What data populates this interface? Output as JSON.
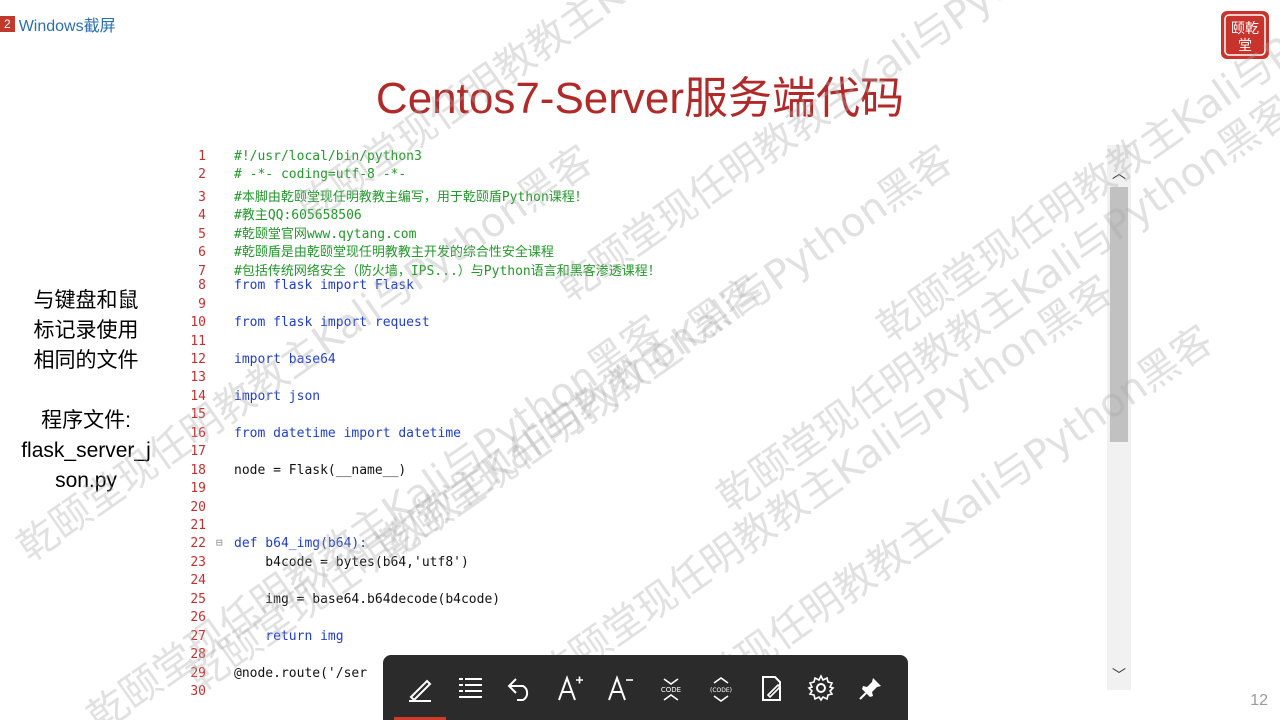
{
  "header": {
    "badge_number": "2",
    "badge_text": "Windows截屏"
  },
  "logo": {
    "text": "乾颐堂"
  },
  "title": "Centos7-Server服务端代码",
  "side_note": {
    "line1": "与键盘和鼠",
    "line2": "标记录使用",
    "line3": "相同的文件",
    "line4": "程序文件:",
    "line5": "flask_server_j",
    "line6": "son.py"
  },
  "code": {
    "lines": [
      {
        "n": "1",
        "t": "#!/usr/local/bin/python3",
        "c": "tok-c"
      },
      {
        "n": "2",
        "t": "# -*- coding=utf-8 -*-",
        "c": "tok-c"
      },
      {
        "n": "3",
        "t": "#本脚由乾颐堂现任明教教主编写，用于乾颐盾Python课程！",
        "c": "tok-c"
      },
      {
        "n": "4",
        "t": "#教主QQ:605658506",
        "c": "tok-c"
      },
      {
        "n": "5",
        "t": "#乾颐堂官网www.qytang.com",
        "c": "tok-c"
      },
      {
        "n": "6",
        "t": "#乾颐盾是由乾颐堂现任明教教主开发的综合性安全课程",
        "c": "tok-c"
      },
      {
        "n": "7",
        "t": "#包括传统网络安全（防火墙，IPS...）与Python语言和黑客渗透课程！",
        "c": "tok-c"
      },
      {
        "n": "8",
        "t": "from flask import Flask",
        "c": "tok-k"
      },
      {
        "n": "9",
        "t": "",
        "c": "tok-n"
      },
      {
        "n": "10",
        "t": "from flask import request",
        "c": "tok-k"
      },
      {
        "n": "11",
        "t": "",
        "c": "tok-n"
      },
      {
        "n": "12",
        "t": "import base64",
        "c": "tok-k"
      },
      {
        "n": "13",
        "t": "",
        "c": "tok-n"
      },
      {
        "n": "14",
        "t": "import json",
        "c": "tok-k"
      },
      {
        "n": "15",
        "t": "",
        "c": "tok-n"
      },
      {
        "n": "16",
        "t": "from datetime import datetime",
        "c": "tok-k"
      },
      {
        "n": "17",
        "t": "",
        "c": "tok-n"
      },
      {
        "n": "18",
        "t": "node = Flask(__name__)",
        "c": "tok-n"
      },
      {
        "n": "19",
        "t": "",
        "c": "tok-n"
      },
      {
        "n": "20",
        "t": "",
        "c": "tok-n"
      },
      {
        "n": "21",
        "t": "",
        "c": "tok-n"
      },
      {
        "n": "22",
        "t": "def b64_img(b64):",
        "c": "tok-k"
      },
      {
        "n": "23",
        "t": "    b4code = bytes(b64,'utf8')",
        "c": "tok-n"
      },
      {
        "n": "24",
        "t": "",
        "c": "tok-n"
      },
      {
        "n": "25",
        "t": "    img = base64.b64decode(b4code)",
        "c": "tok-n"
      },
      {
        "n": "26",
        "t": "",
        "c": "tok-n"
      },
      {
        "n": "27",
        "t": "    return img",
        "c": "tok-k"
      },
      {
        "n": "28",
        "t": "",
        "c": "tok-n"
      },
      {
        "n": "29",
        "t": "@node.route('/ser",
        "c": "tok-n"
      },
      {
        "n": "30",
        "t": "",
        "c": "tok-n"
      }
    ]
  },
  "toolbar": {
    "buttons": [
      {
        "icon": "pen-icon"
      },
      {
        "icon": "list-icon"
      },
      {
        "icon": "undo-icon"
      },
      {
        "icon": "font-increase-icon"
      },
      {
        "icon": "font-decrease-icon"
      },
      {
        "icon": "code-collapse-icon"
      },
      {
        "icon": "code-expand-icon"
      },
      {
        "icon": "note-edit-icon"
      },
      {
        "icon": "settings-icon"
      },
      {
        "icon": "pin-icon"
      }
    ]
  },
  "page_number": "12",
  "watermark": "乾颐堂现任明教教主Kali与Python黑客"
}
